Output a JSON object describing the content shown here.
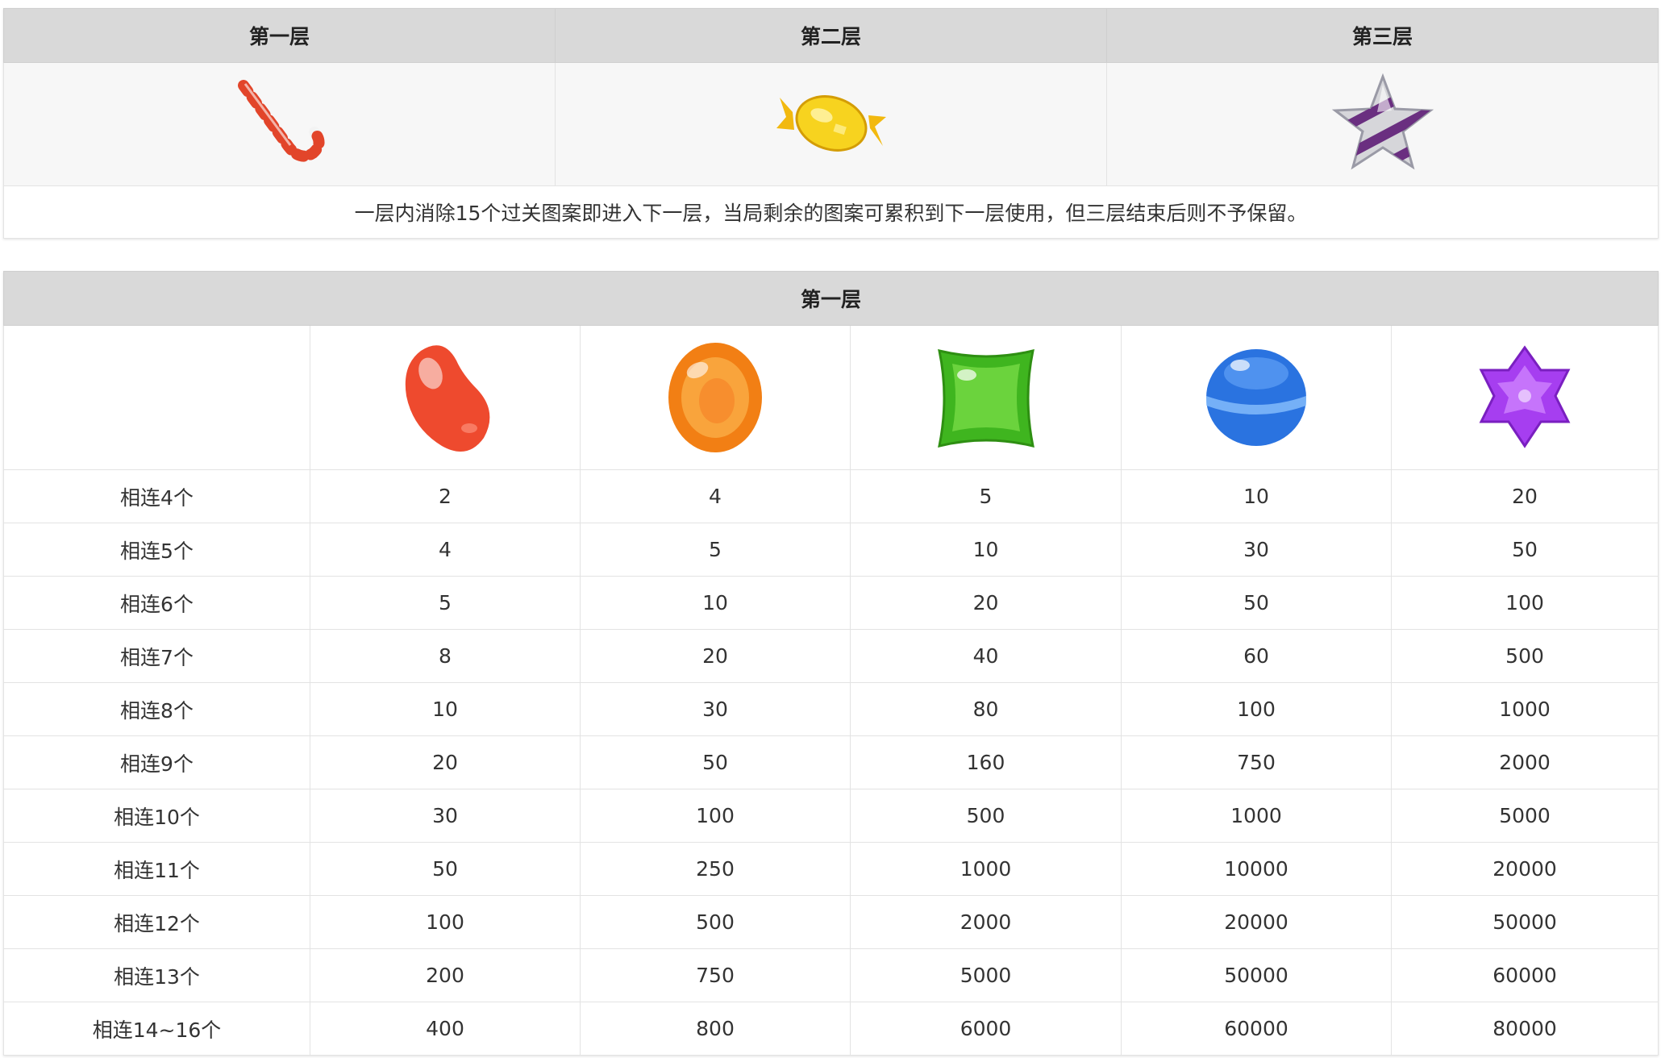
{
  "levels_table": {
    "headers": [
      "第一层",
      "第二层",
      "第三层"
    ],
    "level_icons": [
      "candy-cane-icon",
      "wrapped-candy-icon",
      "striped-star-candy-icon"
    ],
    "note": "一层内消除15个过关图案即进入下一层，当局剩余的图案可累积到下一层使用，但三层结束后则不予保留。"
  },
  "payout_table": {
    "title": "第一层",
    "symbol_icons": [
      "red-jellybean-icon",
      "orange-candy-icon",
      "green-square-candy-icon",
      "blue-ball-candy-icon",
      "purple-star-candy-icon"
    ],
    "colors": {
      "red": "#ef4a2f",
      "orange": "#f58a1f",
      "green": "#4cc22b",
      "blue": "#2f7de6",
      "purple": "#a23cf0"
    },
    "rows": [
      {
        "label": "相连4个",
        "values": [
          "2",
          "4",
          "5",
          "10",
          "20"
        ]
      },
      {
        "label": "相连5个",
        "values": [
          "4",
          "5",
          "10",
          "30",
          "50"
        ]
      },
      {
        "label": "相连6个",
        "values": [
          "5",
          "10",
          "20",
          "50",
          "100"
        ]
      },
      {
        "label": "相连7个",
        "values": [
          "8",
          "20",
          "40",
          "60",
          "500"
        ]
      },
      {
        "label": "相连8个",
        "values": [
          "10",
          "30",
          "80",
          "100",
          "1000"
        ]
      },
      {
        "label": "相连9个",
        "values": [
          "20",
          "50",
          "160",
          "750",
          "2000"
        ]
      },
      {
        "label": "相连10个",
        "values": [
          "30",
          "100",
          "500",
          "1000",
          "5000"
        ]
      },
      {
        "label": "相连11个",
        "values": [
          "50",
          "250",
          "1000",
          "10000",
          "20000"
        ]
      },
      {
        "label": "相连12个",
        "values": [
          "100",
          "500",
          "2000",
          "20000",
          "50000"
        ]
      },
      {
        "label": "相连13个",
        "values": [
          "200",
          "750",
          "5000",
          "50000",
          "60000"
        ]
      },
      {
        "label": "相连14~16个",
        "values": [
          "400",
          "800",
          "6000",
          "60000",
          "80000"
        ]
      }
    ]
  }
}
